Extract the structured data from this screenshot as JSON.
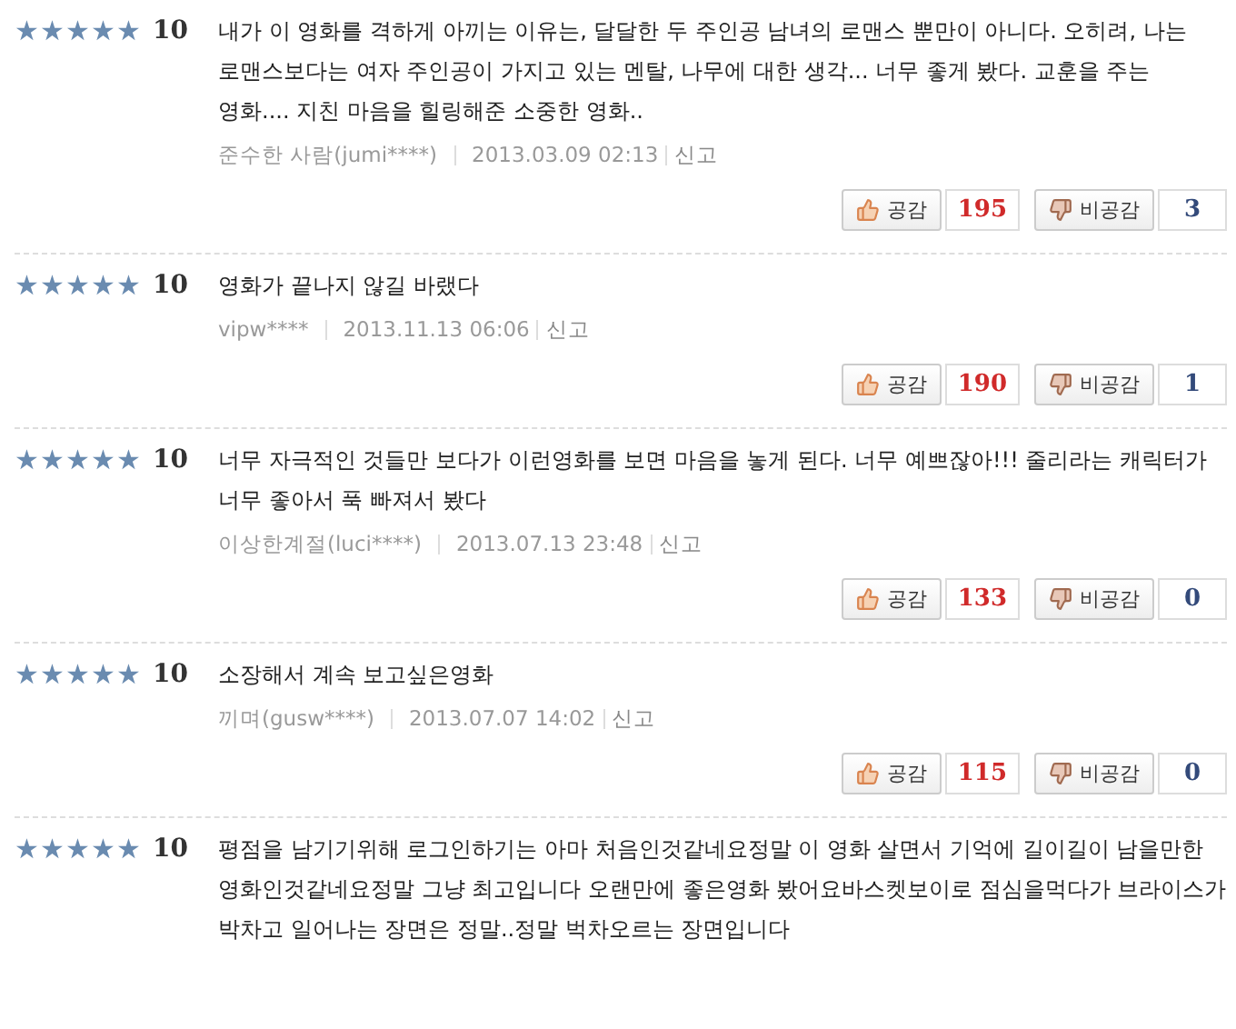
{
  "reviews": [
    {
      "stars": 5,
      "score": "10",
      "text": "내가 이 영화를 격하게 아끼는 이유는, 달달한 두 주인공 남녀의 로맨스 뿐만이 아니다. 오히려, 나는 로맨스보다는 여자 주인공이 가지고 있는 멘탈, 나무에 대한 생각... 너무 좋게 봤다. 교훈을 주는 영화.... 지친 마음을 힐링해준 소중한 영화..",
      "author": "준수한 사람(jumi****)",
      "date": "2013.03.09 02:13",
      "report": "신고",
      "like_label": "공감",
      "like_count": "195",
      "dislike_label": "비공감",
      "dislike_count": "3"
    },
    {
      "stars": 5,
      "score": "10",
      "text": "영화가 끝나지 않길 바랬다",
      "author": "vipw****",
      "date": "2013.11.13 06:06",
      "report": "신고",
      "like_label": "공감",
      "like_count": "190",
      "dislike_label": "비공감",
      "dislike_count": "1"
    },
    {
      "stars": 5,
      "score": "10",
      "text": "너무 자극적인 것들만 보다가 이런영화를 보면 마음을 놓게 된다. 너무 예쁘잖아!!! 줄리라는 캐릭터가 너무 좋아서 푹 빠져서 봤다",
      "author": "이상한계절(luci****)",
      "date": "2013.07.13 23:48",
      "report": "신고",
      "like_label": "공감",
      "like_count": "133",
      "dislike_label": "비공감",
      "dislike_count": "0"
    },
    {
      "stars": 5,
      "score": "10",
      "text": "소장해서 계속 보고싶은영화",
      "author": "끼며(gusw****)",
      "date": "2013.07.07 14:02",
      "report": "신고",
      "like_label": "공감",
      "like_count": "115",
      "dislike_label": "비공감",
      "dislike_count": "0"
    },
    {
      "stars": 5,
      "score": "10",
      "text": "평점을 남기기위해 로그인하기는 아마 처음인것같네요정말 이 영화 살면서 기억에 길이길이 남을만한 영화인것같네요정말 그냥 최고입니다 오랜만에 좋은영화 봤어요바스켓보이로 점심을먹다가 브라이스가 박차고 일어나는 장면은 정말..정말 벅차오르는 장면입니다"
    }
  ]
}
